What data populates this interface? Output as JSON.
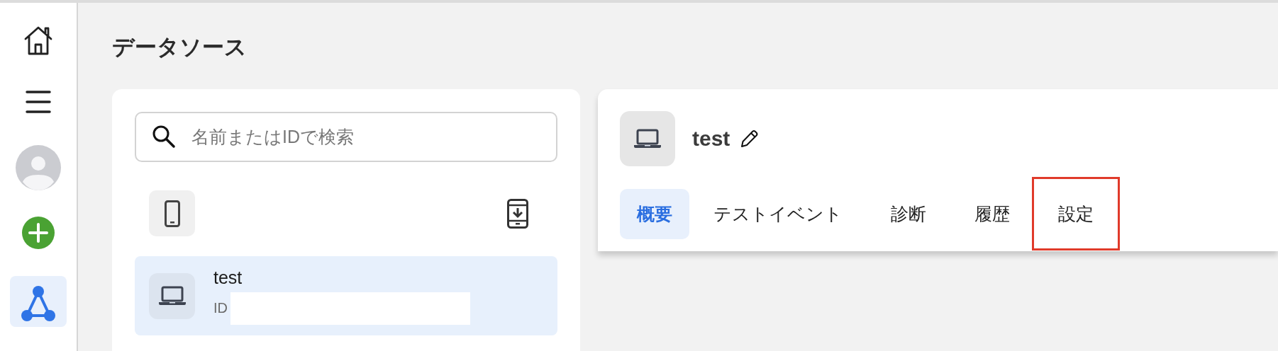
{
  "sidebar": {
    "items": [
      {
        "kind": "home",
        "selected": false
      },
      {
        "kind": "menu",
        "selected": false
      },
      {
        "kind": "avatar",
        "selected": false
      },
      {
        "kind": "add",
        "selected": false
      },
      {
        "kind": "network",
        "selected": true
      }
    ]
  },
  "page_title": "データソース",
  "source_list": {
    "search": {
      "placeholder": "名前またはIDで検索"
    },
    "filters": [
      {
        "kind": "phone",
        "selected": true
      },
      {
        "kind": "download",
        "selected": false
      }
    ],
    "items": [
      {
        "name": "test",
        "id_label": "ID",
        "selected": true
      }
    ]
  },
  "detail": {
    "name": "test",
    "tabs": [
      {
        "label": "概要",
        "selected": true,
        "highlighted": false
      },
      {
        "label": "テストイベント",
        "selected": false,
        "highlighted": false
      },
      {
        "label": "診断",
        "selected": false,
        "highlighted": false
      },
      {
        "label": "履歴",
        "selected": false,
        "highlighted": false
      },
      {
        "label": "設定",
        "selected": false,
        "highlighted": true
      }
    ]
  }
}
